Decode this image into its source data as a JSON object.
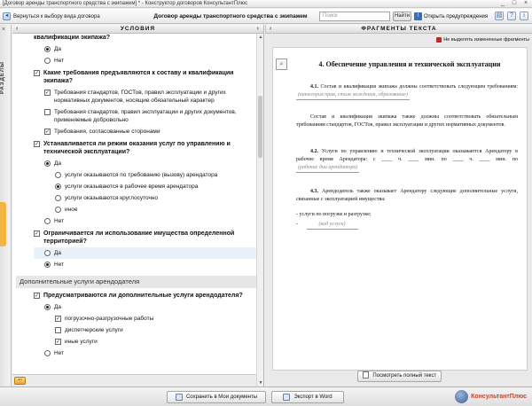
{
  "window": {
    "title": "[Договор аренды транспортного средства с экипажем] * - Конструктор договоров КонсультантПлюс",
    "controls": [
      "_",
      "□",
      "×"
    ]
  },
  "toolbar": {
    "back_label": "Вернуться к выбору вида договора",
    "doc_title": "Договор аренды транспортного средства с экипажем",
    "search_placeholder": "Поиск",
    "find_label": "Найти",
    "warnings_label": "Открыть предупреждения",
    "icons": [
      "print-icon",
      "help-icon",
      "info-icon"
    ]
  },
  "rail": {
    "label": "РАЗДЕЛЫ",
    "close": "×"
  },
  "conditions": {
    "header": "УСЛОВИЯ",
    "q0_text": "квалификации экипажа?",
    "q0_yes": "Да",
    "q0_no": "Нет",
    "q1_text": "Какие требования предъявляются к составу и квалификации экипажа?",
    "q1_opt1": "Требования стандартов, ГОСТов, правил эксплуатации и других нормативных документов, носящие обязательный характер",
    "q1_opt2": "Требования стандартов, правил эксплуатации и других документов, применяемые добровольно",
    "q1_opt3": "Требования, согласованные сторонами",
    "q2_text": "Устанавливается ли режим оказания услуг по управлению и технической эксплуатации?",
    "q2_yes": "Да",
    "q2_sub1": "услуги оказываются  по требованию (вызову) арендатора",
    "q2_sub2": "услуги оказываются в рабочее время арендатора",
    "q2_sub3": "услуги оказываются круглосуточно",
    "q2_sub4": "иное",
    "q2_no": "Нет",
    "q3_text": "Ограничивается ли использование имущества определенной территорией?",
    "q3_yes": "Да",
    "q3_no": "Нет",
    "section2": "Дополнительные услуги арендодателя",
    "q4_text": "Предусматриваются ли дополнительные услуги арендодателя?",
    "q4_yes": "Да",
    "q4_sub1": "погрузочно-разгрузочные работы",
    "q4_sub2": "диспетчерские услуги",
    "q4_sub3": "иные услуги",
    "q4_no": "Нет",
    "nav_arrow": "⇦"
  },
  "fragments": {
    "header": "ФРАГМЕНТЫ ТЕКСТА",
    "hide_label": "Не выделять измененные фрагменты",
    "heading": "4.  Обеспечение управления и технической эксплуатации",
    "p41_num": "4.1.",
    "p41_text": "Состав и квалификация экипажа должны соответствовать следующим требованиям:",
    "p41_fill": "(категория прав, стаж вождения, образование)",
    "p41b_text": "Состав и квалификация экипажа также должны соответствовать обязательным требованиям стандартов, ГОСТов, правил эксплуатации и других нормативных документов.",
    "p42_num": "4.2.",
    "p42_text": "Услуги по управлению и технической эксплуатации оказываются Арендатору в рабочее время Арендатора: с ____ ч. ____ мин. по ____ ч. ____ мин. по",
    "p42_fill": "(рабочие дни арендатора)",
    "p43_num": "4.3.",
    "p43_text": "Арендодатель также оказывает Арендатору следующие дополнительные услуги, связанные с эксплуатацией имущества:",
    "bullet1": "-  услуги по погрузке и разгрузке;",
    "bullet2_prefix": "-",
    "bullet2_fill": "(вид услуги)",
    "preview_label": "Посмотреть полный текст"
  },
  "bottom": {
    "save_label": "Сохранить в Мои документы",
    "export_label": "Экспорт в Word",
    "logo_text": "КонсультантПлюс"
  }
}
